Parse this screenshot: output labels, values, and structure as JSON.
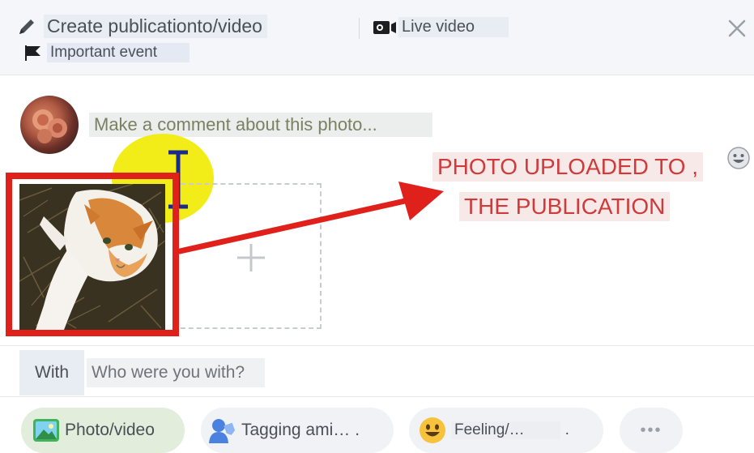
{
  "toolbar": {
    "create_label": "Create publicationto/video",
    "live_label": "Live video",
    "event_label": "Important event"
  },
  "composer": {
    "comment_placeholder": "Make a comment about this photo..."
  },
  "annotation": {
    "line1": "PHOTO UPLOADED TO ,",
    "line2": "THE PUBLICATION"
  },
  "with": {
    "label": "With",
    "placeholder": "Who were you with?"
  },
  "actions": {
    "photo_video": "Photo/video",
    "tagging": "Tagging ami…",
    "tagging_suffix": ".",
    "feeling": "Feeling/…",
    "feeling_suffix": ".",
    "more": "•••"
  },
  "colors": {
    "annotation_red": "#e0201b",
    "highlight_yellow": "#f2ec18"
  }
}
